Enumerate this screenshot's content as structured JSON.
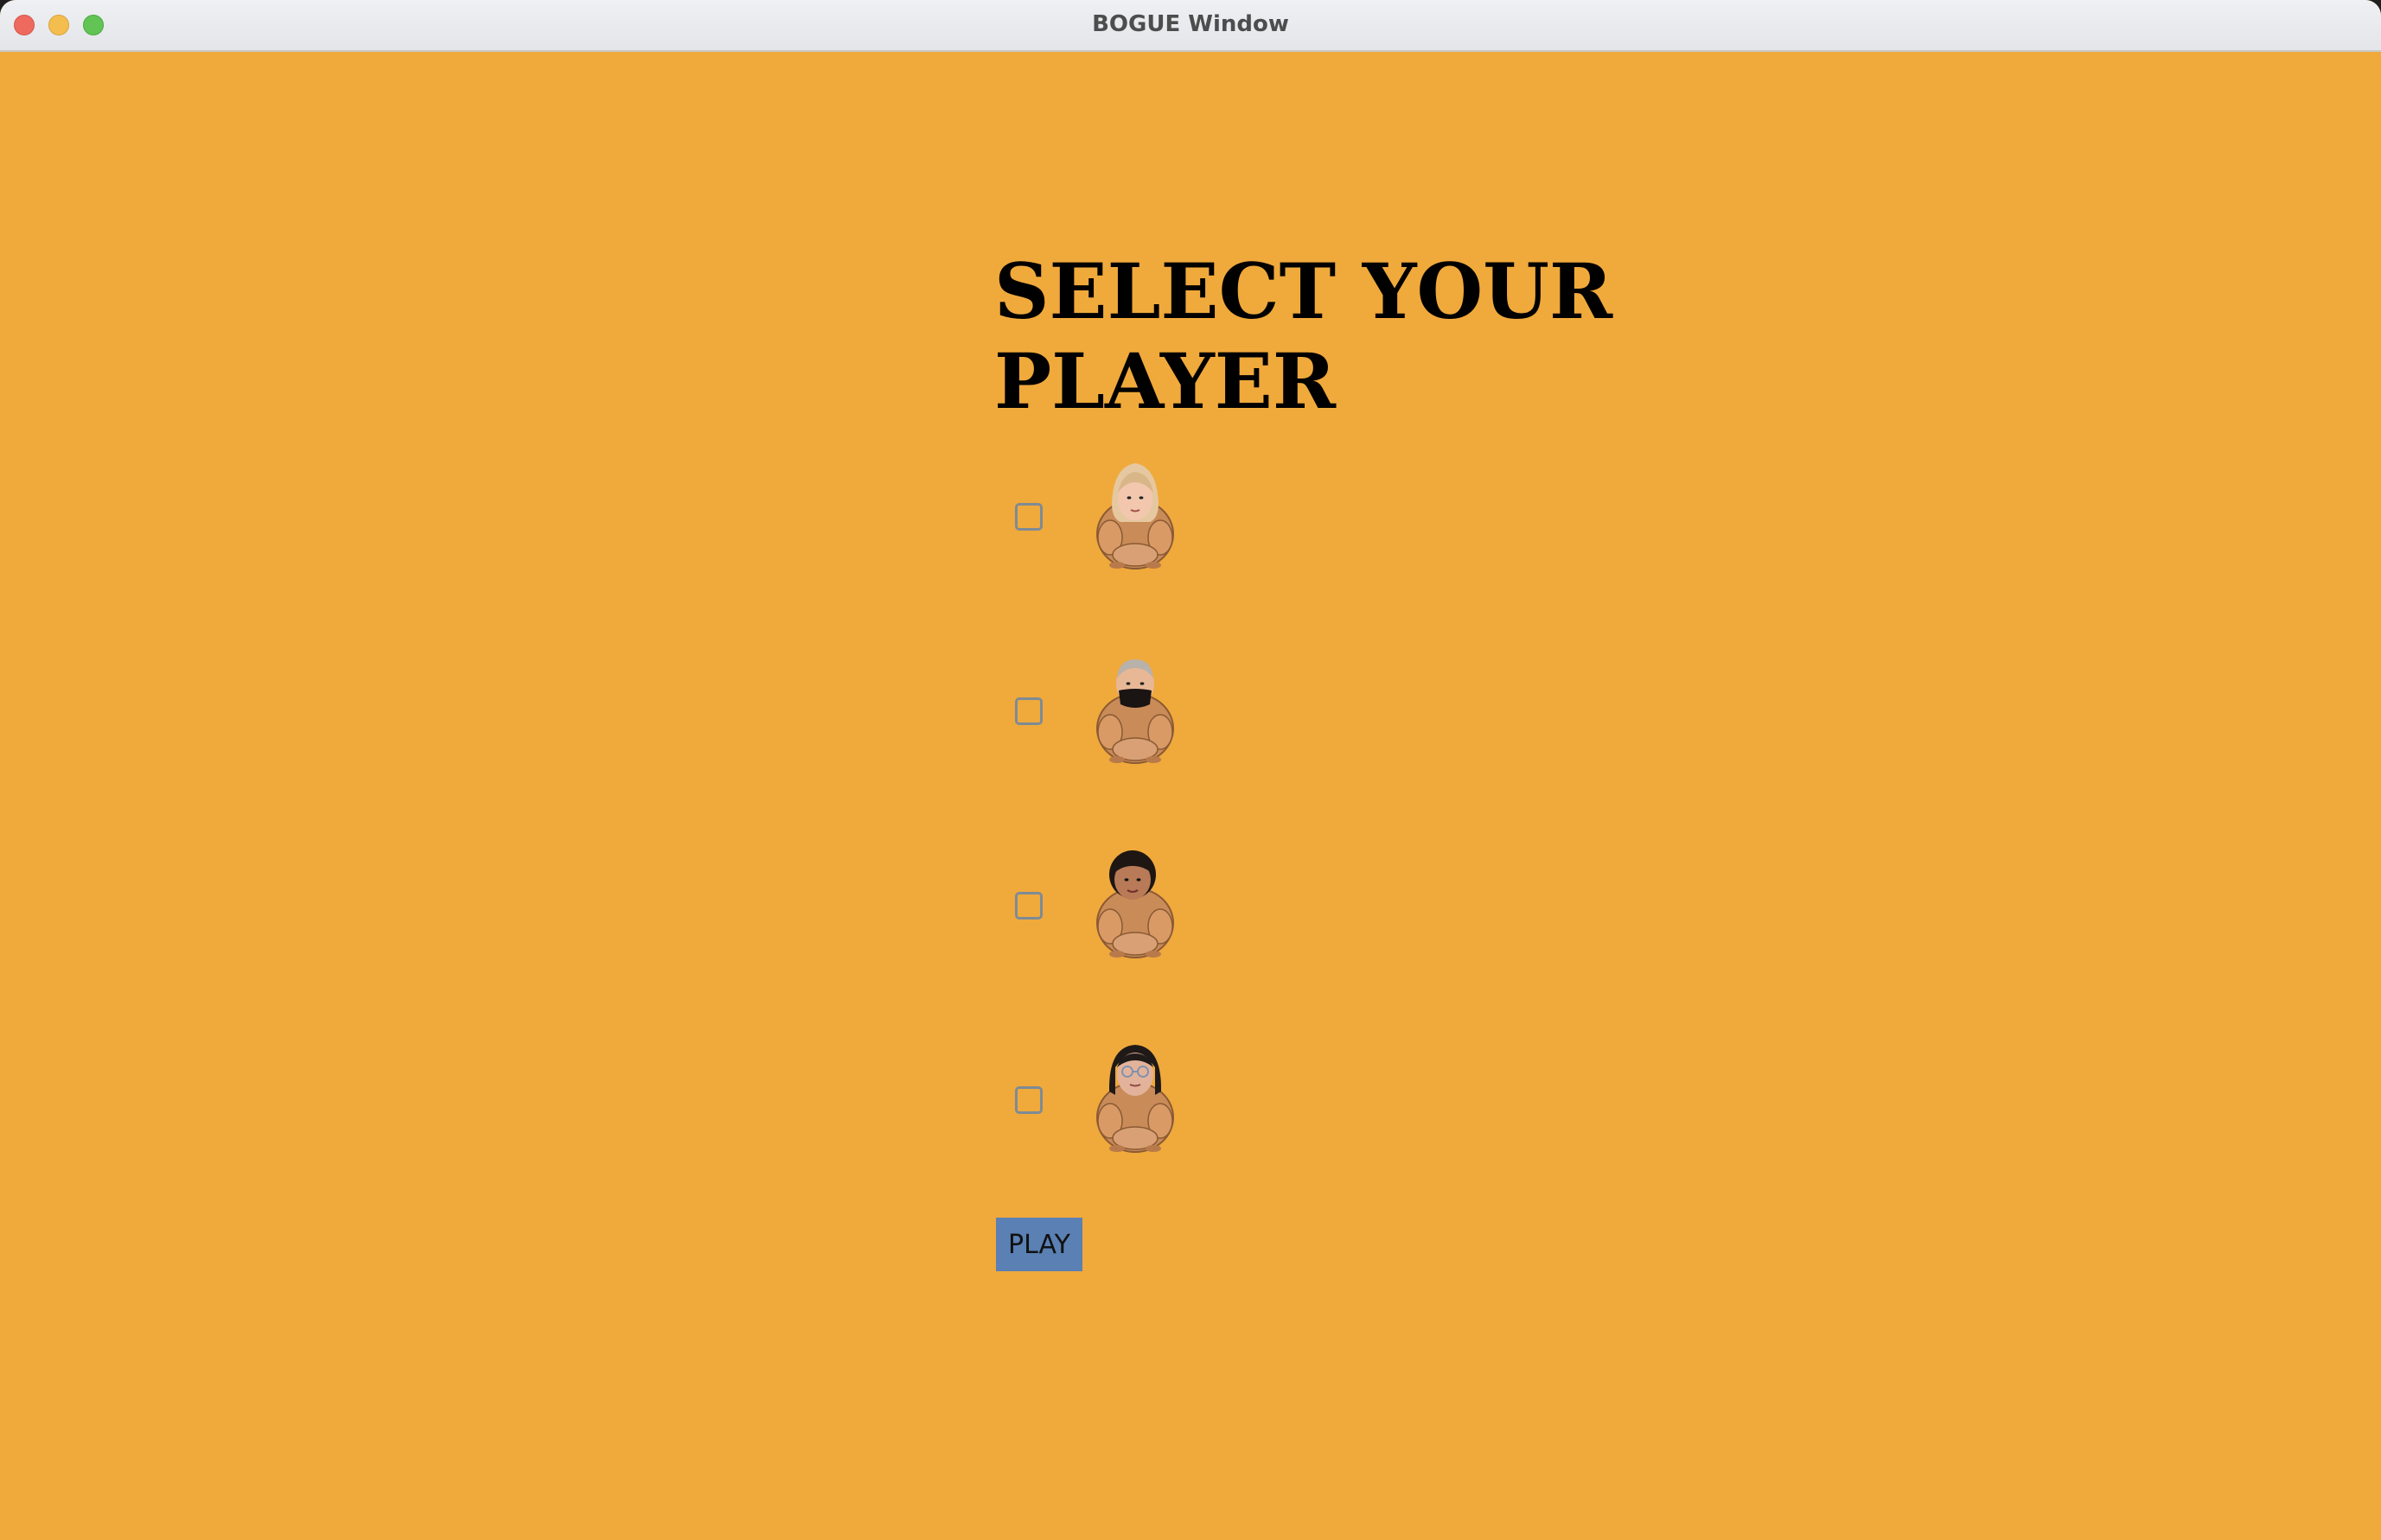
{
  "window": {
    "title": "BOGUE Window"
  },
  "colors": {
    "background": "#F0A93B",
    "button": "#5A80B4",
    "checkbox_border": "#7d8b96"
  },
  "screen": {
    "heading": "SELECT YOUR PLAYER",
    "players": [
      {
        "checked": false,
        "avatar": "hamster-avatar-blonde-hair-icon"
      },
      {
        "checked": false,
        "avatar": "hamster-avatar-masked-icon"
      },
      {
        "checked": false,
        "avatar": "hamster-avatar-dark-hair-icon"
      },
      {
        "checked": false,
        "avatar": "hamster-avatar-glasses-icon"
      }
    ],
    "play_label": "PLAY"
  }
}
